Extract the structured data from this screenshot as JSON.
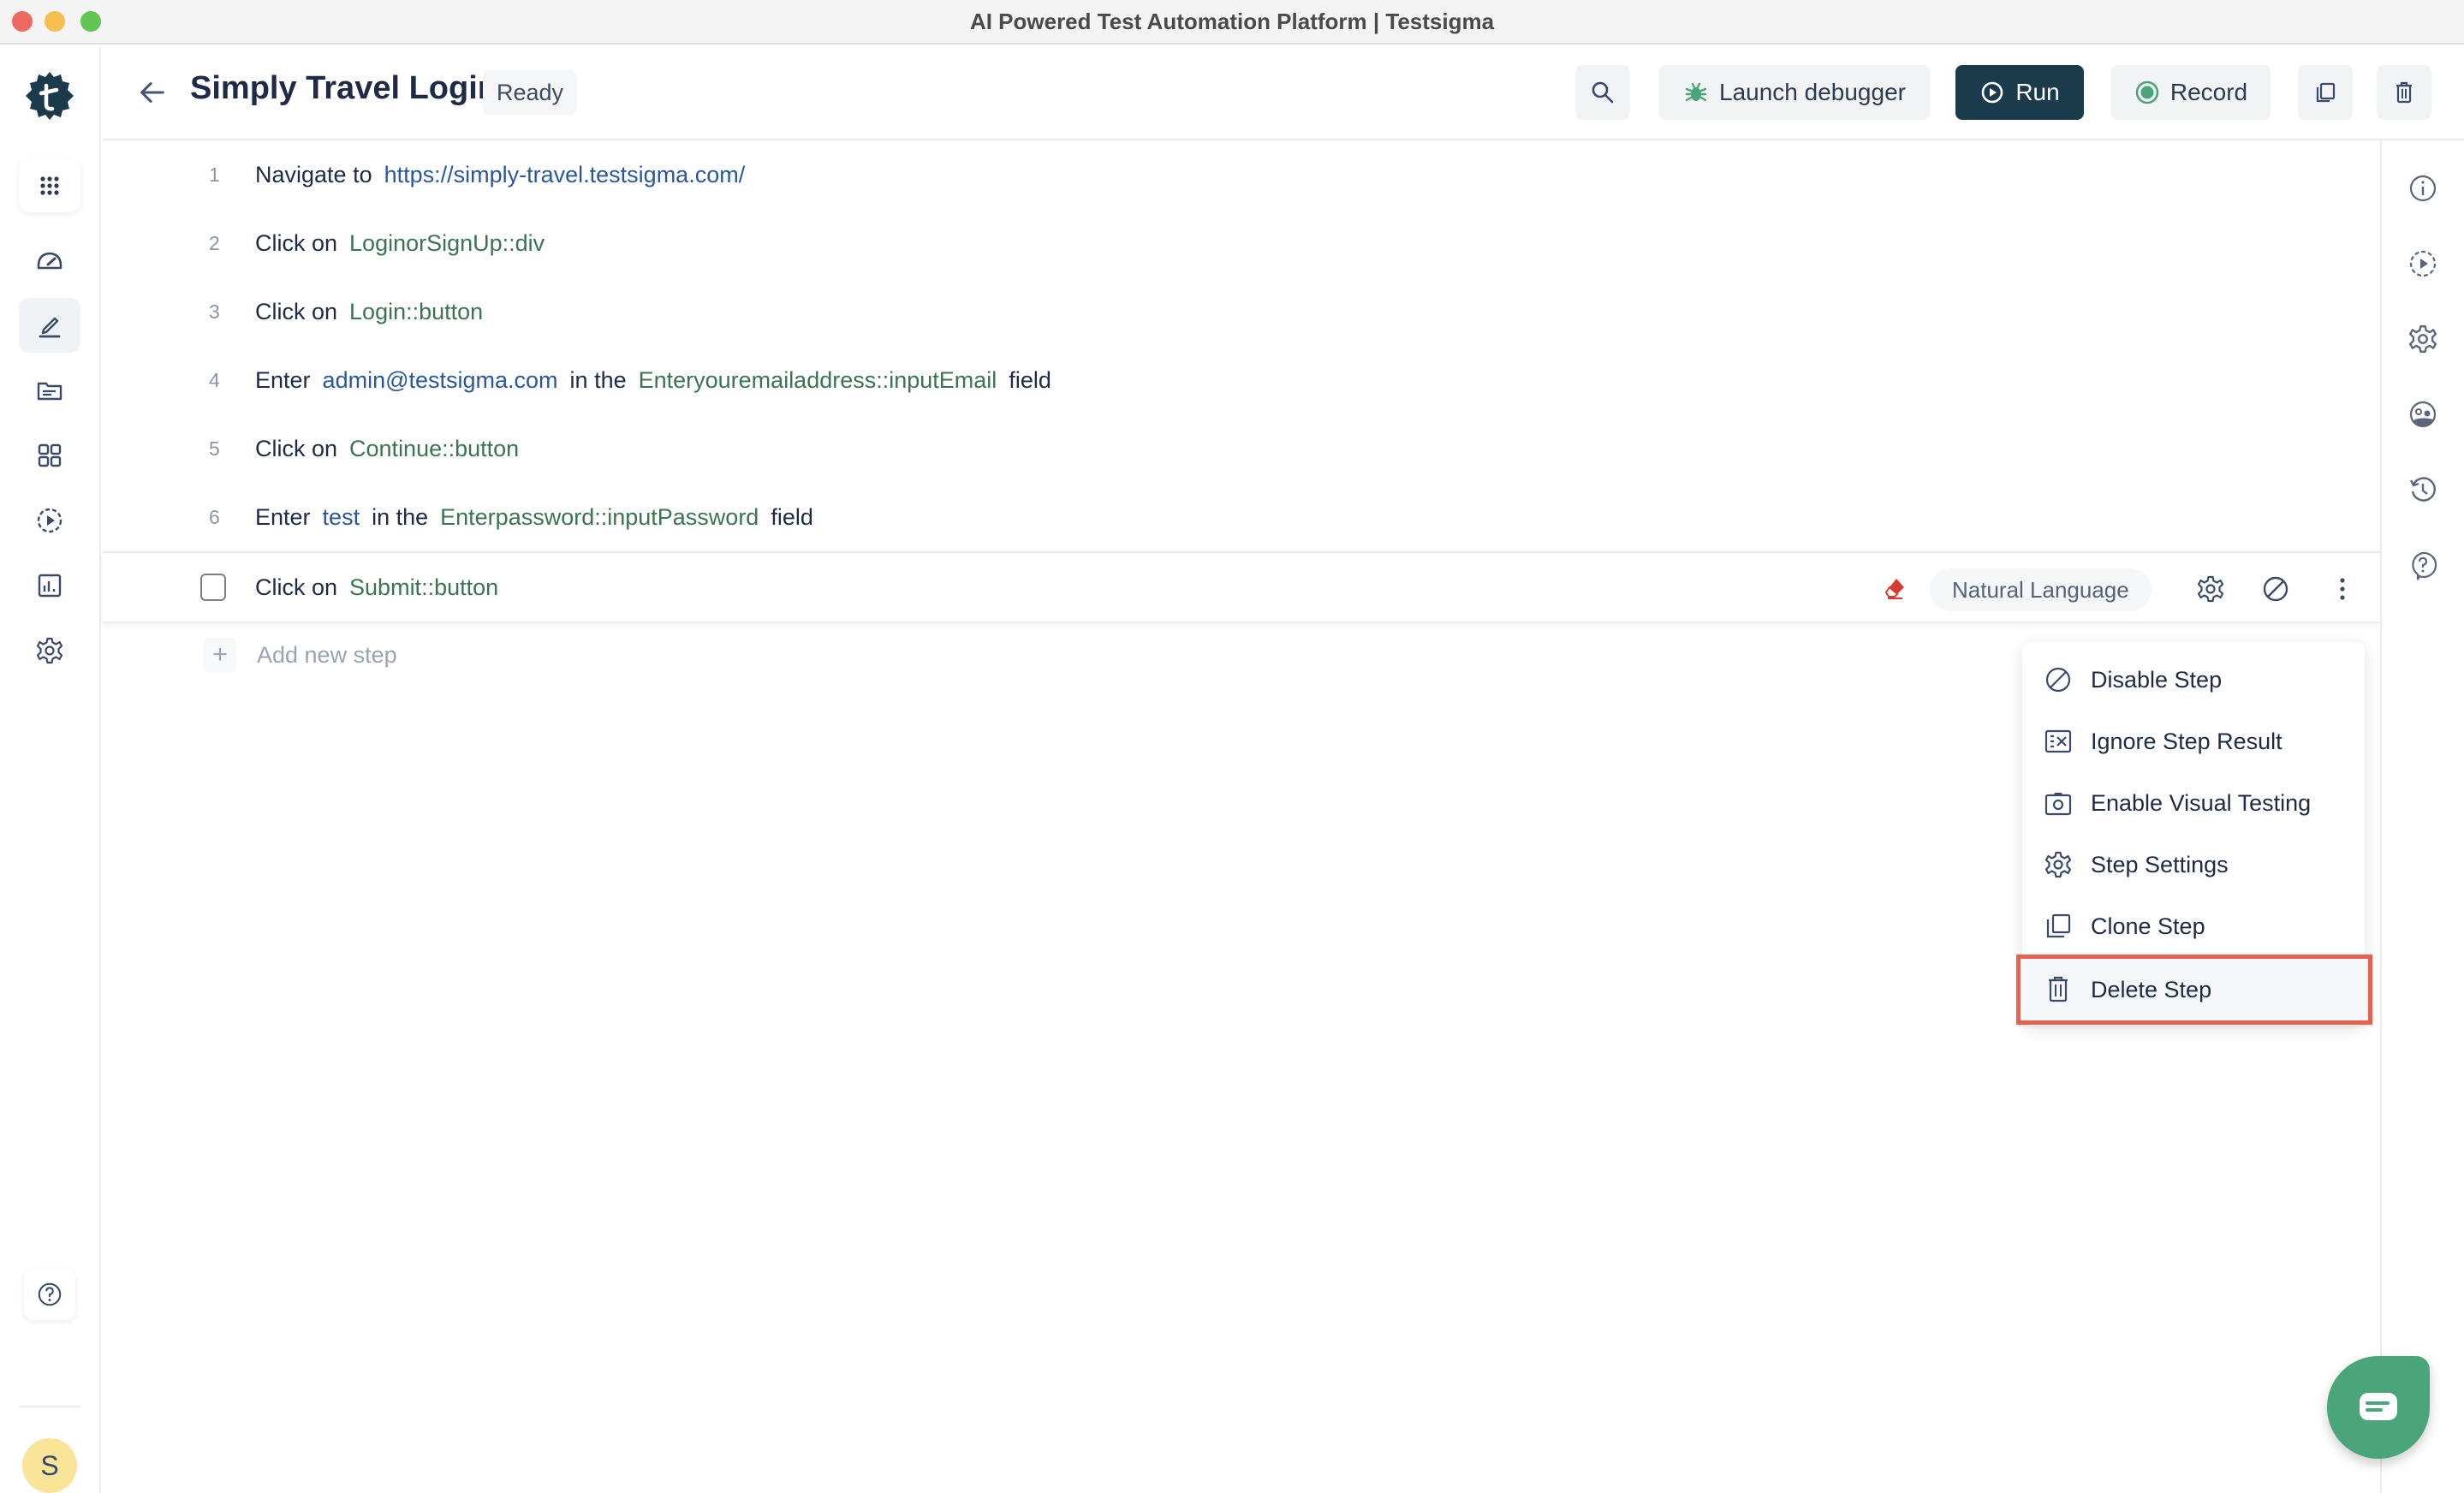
{
  "window": {
    "title": "AI Powered Test Automation Platform | Testsigma"
  },
  "left_sidebar": {
    "items": [
      {
        "name": "apps",
        "icon": "grid-dots-icon"
      },
      {
        "name": "dashboard",
        "icon": "speedometer-icon"
      },
      {
        "name": "test-cases",
        "icon": "pencil-icon",
        "active": true
      },
      {
        "name": "test-data",
        "icon": "folder-icon"
      },
      {
        "name": "elements",
        "icon": "grid-squares-icon"
      },
      {
        "name": "runs",
        "icon": "dashed-play-icon"
      },
      {
        "name": "reports",
        "icon": "bar-chart-icon"
      },
      {
        "name": "settings",
        "icon": "gear-icon"
      }
    ],
    "help_icon": "help-circle-icon",
    "avatar_initial": "S"
  },
  "header": {
    "back_icon": "arrow-left-icon",
    "title": "Simply Travel Login",
    "status": "Ready",
    "buttons": {
      "search_icon": "search-icon",
      "launch_debugger": "Launch debugger",
      "run": "Run",
      "record": "Record",
      "clone_icon": "clone-icon",
      "delete_icon": "trash-icon"
    }
  },
  "steps": [
    {
      "num": "1",
      "parts": [
        {
          "t": "kw",
          "v": "Navigate to"
        },
        {
          "t": "val",
          "v": "https://simply-travel.testsigma.com/"
        }
      ]
    },
    {
      "num": "2",
      "parts": [
        {
          "t": "kw",
          "v": "Click on"
        },
        {
          "t": "el",
          "v": "LoginorSignUp::div"
        }
      ]
    },
    {
      "num": "3",
      "parts": [
        {
          "t": "kw",
          "v": "Click on"
        },
        {
          "t": "el",
          "v": "Login::button"
        }
      ]
    },
    {
      "num": "4",
      "parts": [
        {
          "t": "kw",
          "v": "Enter"
        },
        {
          "t": "val",
          "v": "admin@testsigma.com"
        },
        {
          "t": "kw",
          "v": "in the"
        },
        {
          "t": "el",
          "v": "Enteryouremailaddress::inputEmail"
        },
        {
          "t": "kw",
          "v": "field"
        }
      ]
    },
    {
      "num": "5",
      "parts": [
        {
          "t": "kw",
          "v": "Click on"
        },
        {
          "t": "el",
          "v": "Continue::button"
        }
      ]
    },
    {
      "num": "6",
      "parts": [
        {
          "t": "kw",
          "v": "Enter"
        },
        {
          "t": "val",
          "v": "test"
        },
        {
          "t": "kw",
          "v": "in the"
        },
        {
          "t": "el",
          "v": "Enterpassword::inputPassword"
        },
        {
          "t": "kw",
          "v": "field"
        }
      ]
    }
  ],
  "selected_step": {
    "checked": false,
    "parts": [
      {
        "t": "kw",
        "v": "Click on"
      },
      {
        "t": "el",
        "v": "Submit::button"
      }
    ],
    "mode_label": "Natural Language"
  },
  "add_step": {
    "label": "Add new step"
  },
  "context_menu": {
    "items": [
      {
        "label": "Disable Step",
        "icon": "disable-icon"
      },
      {
        "label": "Ignore Step Result",
        "icon": "ignore-result-icon"
      },
      {
        "label": "Enable Visual Testing",
        "icon": "camera-icon"
      },
      {
        "label": "Step Settings",
        "icon": "gear-icon"
      },
      {
        "label": "Clone Step",
        "icon": "clone-icon"
      },
      {
        "label": "Delete Step",
        "icon": "trash-icon",
        "highlighted": true
      }
    ]
  },
  "right_rail": {
    "items": [
      "info-icon",
      "dashed-play-icon",
      "gear-icon",
      "visual-test-icon",
      "history-icon",
      "help-chat-icon"
    ]
  },
  "chat": {
    "icon": "chat-icon"
  },
  "colors": {
    "primary_dark": "#1b3a4c",
    "element_green": "#3b7452",
    "value_blue": "#2857a0",
    "highlight_red": "#e8604f",
    "chat_green": "#4aa57a",
    "avatar_yellow": "#f9e497"
  }
}
